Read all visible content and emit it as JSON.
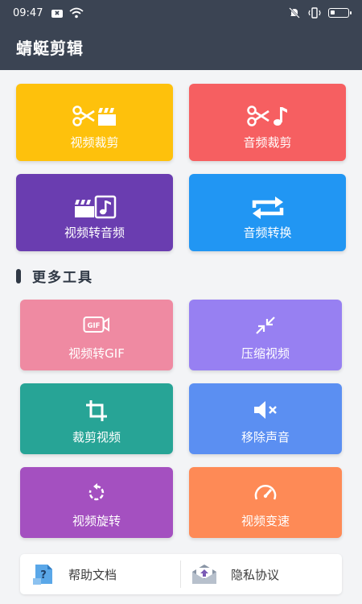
{
  "status_bar": {
    "time": "09:47",
    "notif_badge": "✖"
  },
  "app": {
    "title": "蜻蜓剪辑"
  },
  "main_tools": [
    {
      "label": "视频裁剪",
      "color": "#fec10c",
      "icon": "scissors-clapper-icon"
    },
    {
      "label": "音频裁剪",
      "color": "#f65f61",
      "icon": "scissors-note-icon"
    },
    {
      "label": "视频转音频",
      "color": "#6a3db0",
      "icon": "clapper-note-icon"
    },
    {
      "label": "音频转换",
      "color": "#2196f3",
      "icon": "repeat-icon"
    }
  ],
  "section": {
    "title": "更多工具"
  },
  "more_tools": [
    {
      "label": "视频转GIF",
      "color": "#ef8aa2",
      "icon": "gif-camera-icon"
    },
    {
      "label": "压缩视频",
      "color": "#9780f2",
      "icon": "compress-icon"
    },
    {
      "label": "裁剪视频",
      "color": "#27a496",
      "icon": "crop-icon"
    },
    {
      "label": "移除声音",
      "color": "#5b8ff2",
      "icon": "mute-icon"
    },
    {
      "label": "视频旋转",
      "color": "#a450c0",
      "icon": "rotate-icon"
    },
    {
      "label": "视频变速",
      "color": "#fe8a56",
      "icon": "speedometer-icon"
    }
  ],
  "bottom_links": [
    {
      "label": "帮助文档",
      "icon": "help-doc-icon"
    },
    {
      "label": "隐私协议",
      "icon": "privacy-envelope-icon"
    }
  ]
}
